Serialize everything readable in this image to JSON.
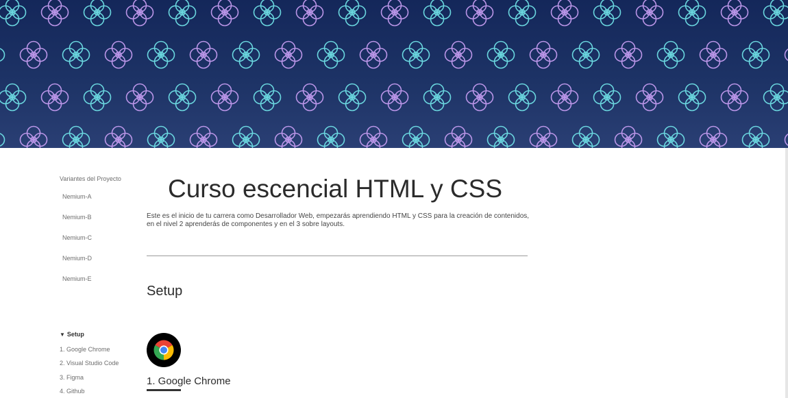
{
  "sidebar": {
    "variants_heading": "Variantes del Proyecto",
    "variants": [
      "Nemium-A",
      "Nemium-B",
      "Nemium-C",
      "Nemium-D",
      "Nemium-E"
    ],
    "toc": {
      "section_label": "Setup",
      "caret_icon": "triangle-down-icon",
      "items": [
        "1. Google Chrome",
        "2. Visual Studio Code",
        "3. Figma",
        "4. Github"
      ]
    }
  },
  "main": {
    "title": "Curso escencial HTML y CSS",
    "intro": "Este es el inicio de tu carrera como Desarrollador Web, empezarás aprendiendo HTML y CSS para la creación de contenidos, en el nivel 2 aprenderás de componentes y en el 3 sobre layouts.",
    "section_title": "Setup",
    "first_item": {
      "title": "1. Google Chrome",
      "icon": "google-chrome-icon"
    }
  },
  "colors": {
    "banner_bg": "#1a2e62",
    "pattern_cyan": "#6fe0e6",
    "pattern_lilac": "#c49cf0"
  }
}
